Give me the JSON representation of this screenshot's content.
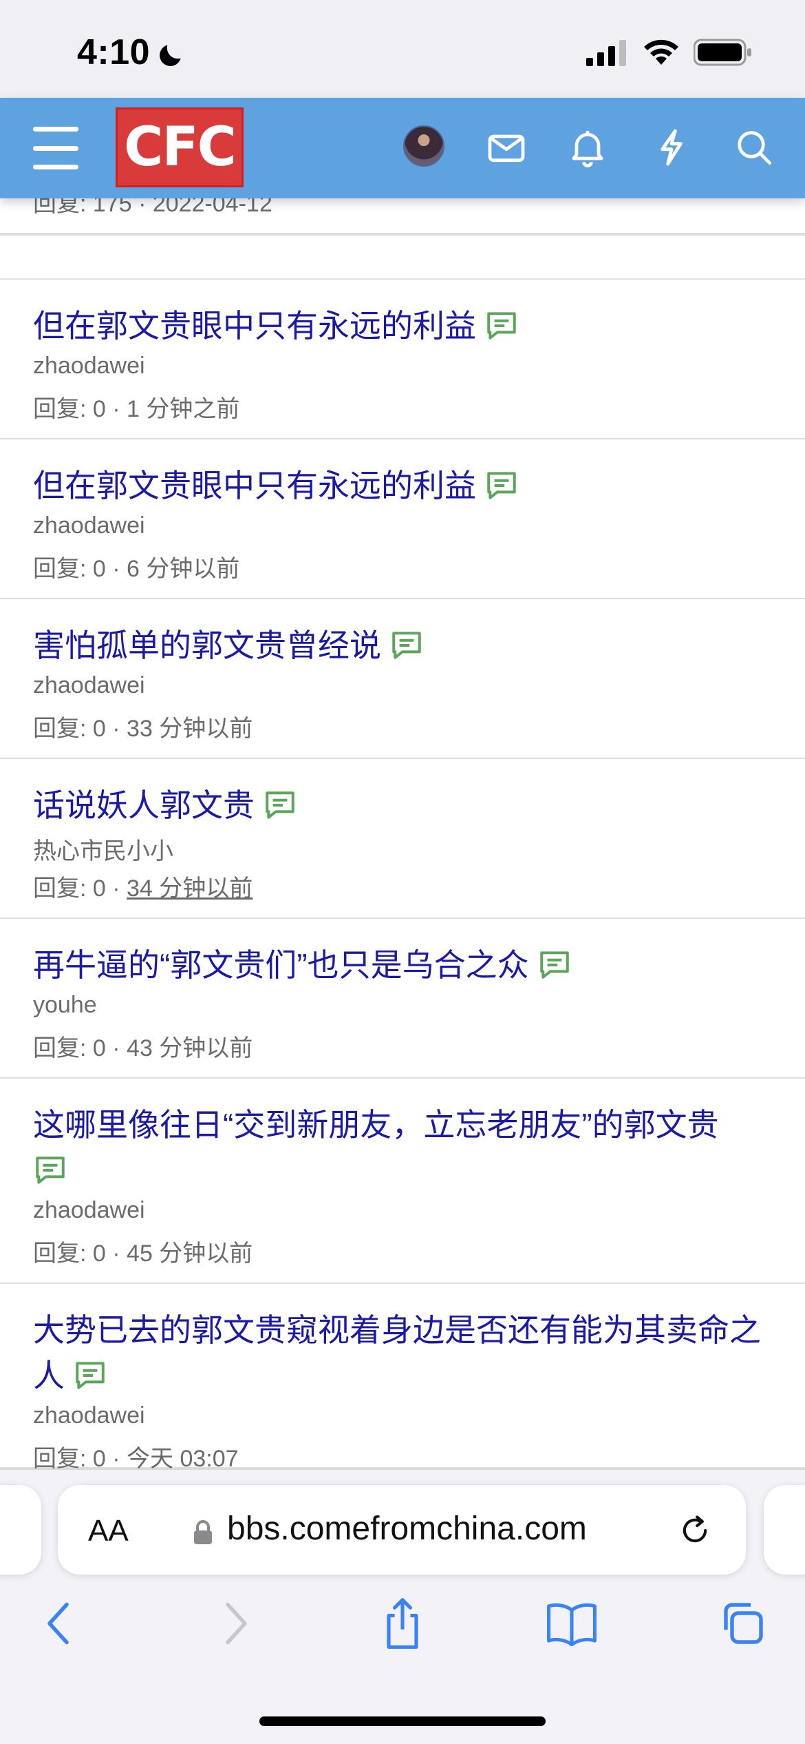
{
  "status": {
    "time": "4:10"
  },
  "header": {
    "logo_text": "CFC"
  },
  "partial_item": {
    "meta": "回复: 175 · 2022-04-12"
  },
  "threads": [
    {
      "title": "但在郭文贵眼中只有永远的利益",
      "author": "zhaodawei",
      "replies": "回复: 0",
      "time": "1 分钟之前"
    },
    {
      "title": "但在郭文贵眼中只有永远的利益",
      "author": "zhaodawei",
      "replies": "回复: 0",
      "time": "6 分钟以前"
    },
    {
      "title": "害怕孤单的郭文贵曾经说",
      "author": "zhaodawei",
      "replies": "回复: 0",
      "time": "33 分钟以前"
    },
    {
      "title": "话说妖人郭文贵",
      "author": "热心市民小小",
      "replies": "回复: 0",
      "time": "34 分钟以前"
    },
    {
      "title": "再牛逼的“郭文贵们”也只是乌合之众",
      "author": "youhe",
      "replies": "回复: 0",
      "time": "43 分钟以前"
    },
    {
      "title": "这哪里像往日“交到新朋友，立忘老朋友”的郭文贵",
      "author": "zhaodawei",
      "replies": "回复: 0",
      "time": "45 分钟以前"
    },
    {
      "title": "大势已去的郭文贵窥视着身边是否还有能为其卖命之人",
      "author": "zhaodawei",
      "replies": "回复: 0",
      "time": "今天 03:07"
    }
  ],
  "browser": {
    "text_size_label": "AA",
    "url": "bbs.comefromchina.com"
  },
  "icons": {
    "menu": "hamburger-menu-icon",
    "mail": "mail-icon",
    "bell": "bell-icon",
    "bolt": "lightning-icon",
    "search": "search-icon",
    "comment": "comment-icon"
  },
  "colors": {
    "header_bg": "#5fa2e0",
    "logo_bg": "#d93a3a",
    "title_link": "#1a1aa6",
    "comment_icon": "#5aa55a",
    "ios_blue": "#3a82f7"
  }
}
